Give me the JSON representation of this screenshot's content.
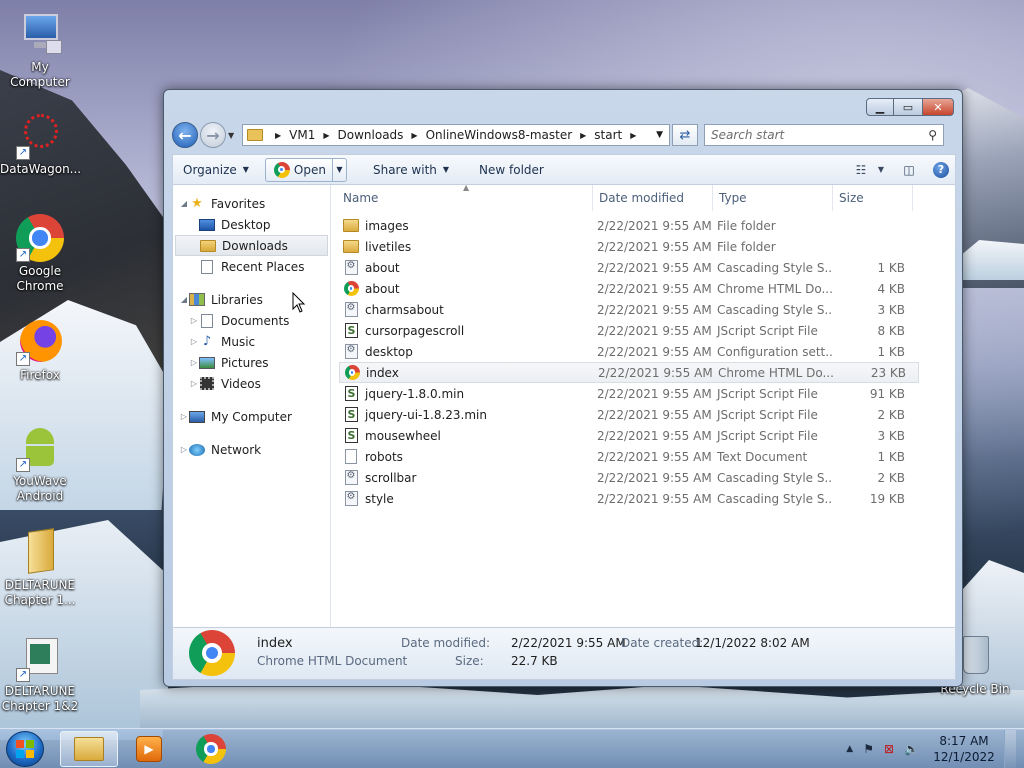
{
  "desktop": {
    "icons": [
      {
        "label": "My Computer"
      },
      {
        "label": "DataWagon..."
      },
      {
        "label": "Google Chrome"
      },
      {
        "label": "Firefox"
      },
      {
        "label": "YouWave Android"
      },
      {
        "label": "DELTARUNE Chapter 1..."
      },
      {
        "label": "DELTARUNE Chapter 1&2"
      },
      {
        "label": "Recycle Bin"
      }
    ]
  },
  "window": {
    "controls": {
      "minimize": "▁",
      "maximize": "▭",
      "close": "✕"
    },
    "breadcrumb": [
      "VM1",
      "Downloads",
      "OnlineWindows8-master",
      "start"
    ],
    "search_placeholder": "Search start",
    "toolbar": {
      "organize": "Organize",
      "open": "Open",
      "share_with": "Share with",
      "new_folder": "New folder"
    },
    "nav": {
      "favorites": "Favorites",
      "desktop": "Desktop",
      "downloads": "Downloads",
      "recent_places": "Recent Places",
      "libraries": "Libraries",
      "documents": "Documents",
      "music": "Music",
      "pictures": "Pictures",
      "videos": "Videos",
      "my_computer": "My Computer",
      "network": "Network"
    },
    "columns": {
      "name": "Name",
      "date": "Date modified",
      "type": "Type",
      "size": "Size"
    },
    "files": [
      {
        "name": "images",
        "date": "2/22/2021 9:55 AM",
        "type": "File folder",
        "size": "",
        "icon": "folder-icon"
      },
      {
        "name": "livetiles",
        "date": "2/22/2021 9:55 AM",
        "type": "File folder",
        "size": "",
        "icon": "folder-icon"
      },
      {
        "name": "about",
        "date": "2/22/2021 9:55 AM",
        "type": "Cascading Style S...",
        "size": "1 KB",
        "icon": "css-file-icon"
      },
      {
        "name": "about",
        "date": "2/22/2021 9:55 AM",
        "type": "Chrome HTML Do...",
        "size": "4 KB",
        "icon": "chrome-icon"
      },
      {
        "name": "charmsabout",
        "date": "2/22/2021 9:55 AM",
        "type": "Cascading Style S...",
        "size": "3 KB",
        "icon": "css-file-icon"
      },
      {
        "name": "cursorpagescroll",
        "date": "2/22/2021 9:55 AM",
        "type": "JScript Script File",
        "size": "8 KB",
        "icon": "js-file-icon"
      },
      {
        "name": "desktop",
        "date": "2/22/2021 9:55 AM",
        "type": "Configuration sett...",
        "size": "1 KB",
        "icon": "config-file-icon"
      },
      {
        "name": "index",
        "date": "2/22/2021 9:55 AM",
        "type": "Chrome HTML Do...",
        "size": "23 KB",
        "icon": "chrome-icon"
      },
      {
        "name": "jquery-1.8.0.min",
        "date": "2/22/2021 9:55 AM",
        "type": "JScript Script File",
        "size": "91 KB",
        "icon": "js-file-icon"
      },
      {
        "name": "jquery-ui-1.8.23.min",
        "date": "2/22/2021 9:55 AM",
        "type": "JScript Script File",
        "size": "2 KB",
        "icon": "js-file-icon"
      },
      {
        "name": "mousewheel",
        "date": "2/22/2021 9:55 AM",
        "type": "JScript Script File",
        "size": "3 KB",
        "icon": "js-file-icon"
      },
      {
        "name": "robots",
        "date": "2/22/2021 9:55 AM",
        "type": "Text Document",
        "size": "1 KB",
        "icon": "text-file-icon"
      },
      {
        "name": "scrollbar",
        "date": "2/22/2021 9:55 AM",
        "type": "Cascading Style S...",
        "size": "2 KB",
        "icon": "css-file-icon"
      },
      {
        "name": "style",
        "date": "2/22/2021 9:55 AM",
        "type": "Cascading Style S...",
        "size": "19 KB",
        "icon": "css-file-icon"
      }
    ],
    "details": {
      "name": "index",
      "type": "Chrome HTML Document",
      "date_modified_label": "Date modified:",
      "date_modified": "2/22/2021 9:55 AM",
      "size_label": "Size:",
      "size": "22.7 KB",
      "date_created_label": "Date created:",
      "date_created": "12/1/2022 8:02 AM"
    }
  },
  "taskbar": {
    "time": "8:17 AM",
    "date": "12/1/2022"
  }
}
